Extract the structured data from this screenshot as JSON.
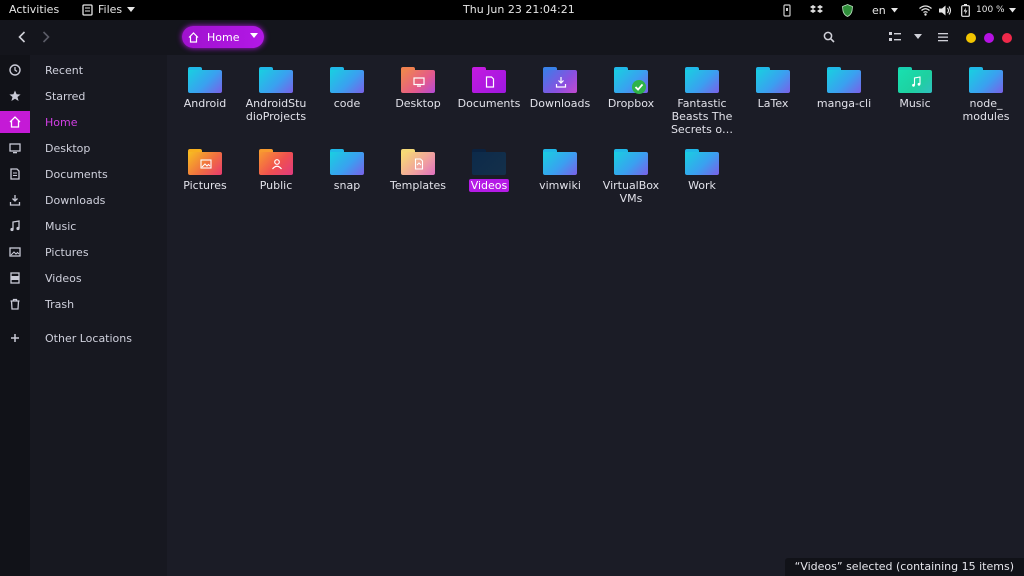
{
  "topbar": {
    "activities": "Activities",
    "app_menu": "Files",
    "clock": "Thu Jun 23  21:04:21",
    "keyboard_layout": "en",
    "battery": "100 %"
  },
  "headerbar": {
    "path_label": "Home"
  },
  "sidebar": {
    "items": [
      {
        "label": "Recent",
        "icon": "clock-icon"
      },
      {
        "label": "Starred",
        "icon": "star-icon"
      },
      {
        "label": "Home",
        "icon": "home-icon",
        "active": true
      },
      {
        "label": "Desktop",
        "icon": "desktop-icon"
      },
      {
        "label": "Documents",
        "icon": "document-icon"
      },
      {
        "label": "Downloads",
        "icon": "download-icon"
      },
      {
        "label": "Music",
        "icon": "music-icon"
      },
      {
        "label": "Pictures",
        "icon": "picture-icon"
      },
      {
        "label": "Videos",
        "icon": "video-icon"
      },
      {
        "label": "Trash",
        "icon": "trash-icon"
      },
      {
        "label": "Other Locations",
        "icon": "plus-icon"
      }
    ]
  },
  "folders": [
    {
      "name": "Android",
      "style": "teal"
    },
    {
      "name": "AndroidStu\ndioProjects",
      "style": "teal"
    },
    {
      "name": "code",
      "style": "teal"
    },
    {
      "name": "Desktop",
      "style": "pinkorange",
      "emblem": "desktop"
    },
    {
      "name": "Documents",
      "style": "purple",
      "emblem": "document"
    },
    {
      "name": "Downloads",
      "style": "bluepurple",
      "emblem": "download"
    },
    {
      "name": "Dropbox",
      "style": "teal",
      "emblem": "check"
    },
    {
      "name": "Fantastic\nBeasts The\nSecrets o…",
      "style": "teal"
    },
    {
      "name": "LaTex",
      "style": "teal"
    },
    {
      "name": "manga-cli",
      "style": "teal"
    },
    {
      "name": "Music",
      "style": "green",
      "emblem": "music"
    },
    {
      "name": "node_\nmodules",
      "style": "teal"
    },
    {
      "name": "Pictures",
      "style": "yellowred",
      "emblem": "picture"
    },
    {
      "name": "Public",
      "style": "orangered",
      "emblem": "person"
    },
    {
      "name": "snap",
      "style": "teal"
    },
    {
      "name": "Templates",
      "style": "yellowpink",
      "emblem": "template"
    },
    {
      "name": "Videos",
      "style": "dark",
      "selected": true
    },
    {
      "name": "vimwiki",
      "style": "teal"
    },
    {
      "name": "VirtualBox\nVMs",
      "style": "teal"
    },
    {
      "name": "Work",
      "style": "teal"
    }
  ],
  "status": {
    "text": "“Videos” selected  (containing 15 items)"
  },
  "colors": {
    "accent": "#b51be6",
    "window_dots": [
      "#f2c500",
      "#b612e3",
      "#f0294a"
    ]
  }
}
